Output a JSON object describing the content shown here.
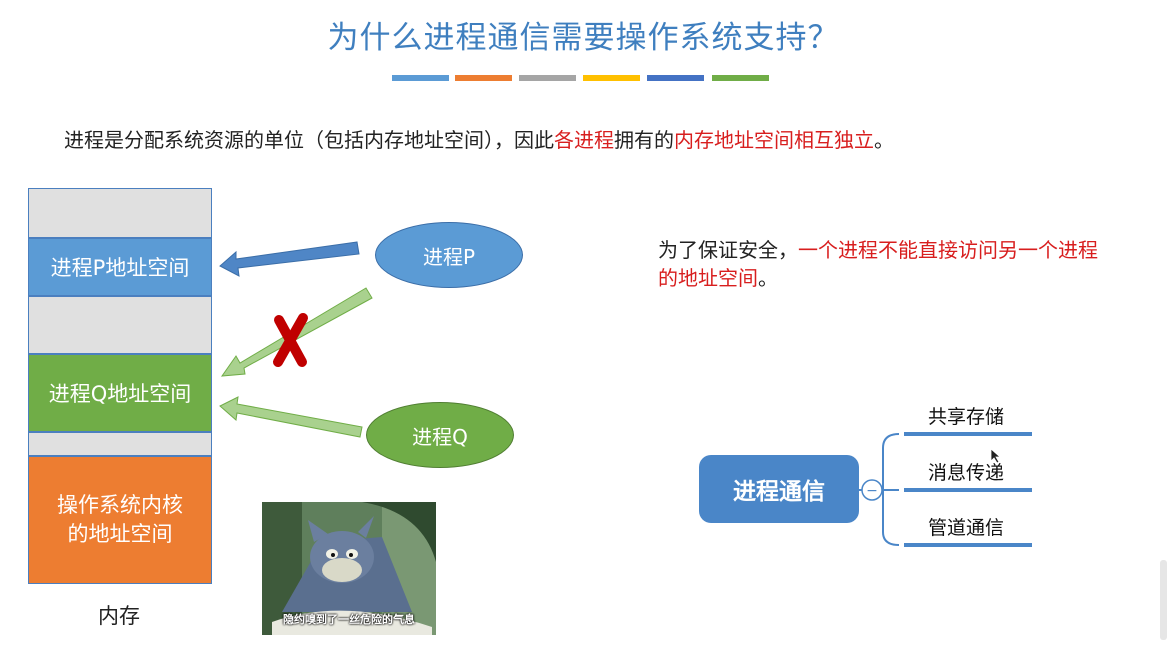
{
  "title": "为什么进程通信需要操作系统支持？",
  "color_bars": [
    "#5b9bd5",
    "#ed7d31",
    "#a5a5a5",
    "#ffc000",
    "#4472c4",
    "#70ad47"
  ],
  "intro": {
    "part1": "进程是分配系统资源的单位（包括内存地址空间），因此",
    "part2_red": "各进程",
    "part3": "拥有的",
    "part4_red": "内存地址空间相互独立",
    "part5": "。"
  },
  "memory": {
    "p_space": "进程P地址空间",
    "q_space": "进程Q地址空间",
    "kernel_line1": "操作系统内核",
    "kernel_line2": "的地址空间",
    "label": "内存"
  },
  "processes": {
    "p": "进程P",
    "q": "进程Q"
  },
  "note": {
    "part1": "为了保证安全，",
    "part2_red": "一个进程不能直接访问另一个进程的地址空间",
    "part3": "。"
  },
  "mindmap": {
    "root": "进程通信",
    "collapse_symbol": "−",
    "branches": [
      "共享存储",
      "消息传递",
      "管道通信"
    ]
  },
  "meme": {
    "caption": "隐约嗅到了一丝危险的气息"
  },
  "colors": {
    "title": "#3f7fbf",
    "blue_block": "#5b9bd5",
    "green_block": "#70ad47",
    "kernel_block": "#ed7d31",
    "red_text": "#d81e1e",
    "mindmap_root": "#4a86c8"
  }
}
